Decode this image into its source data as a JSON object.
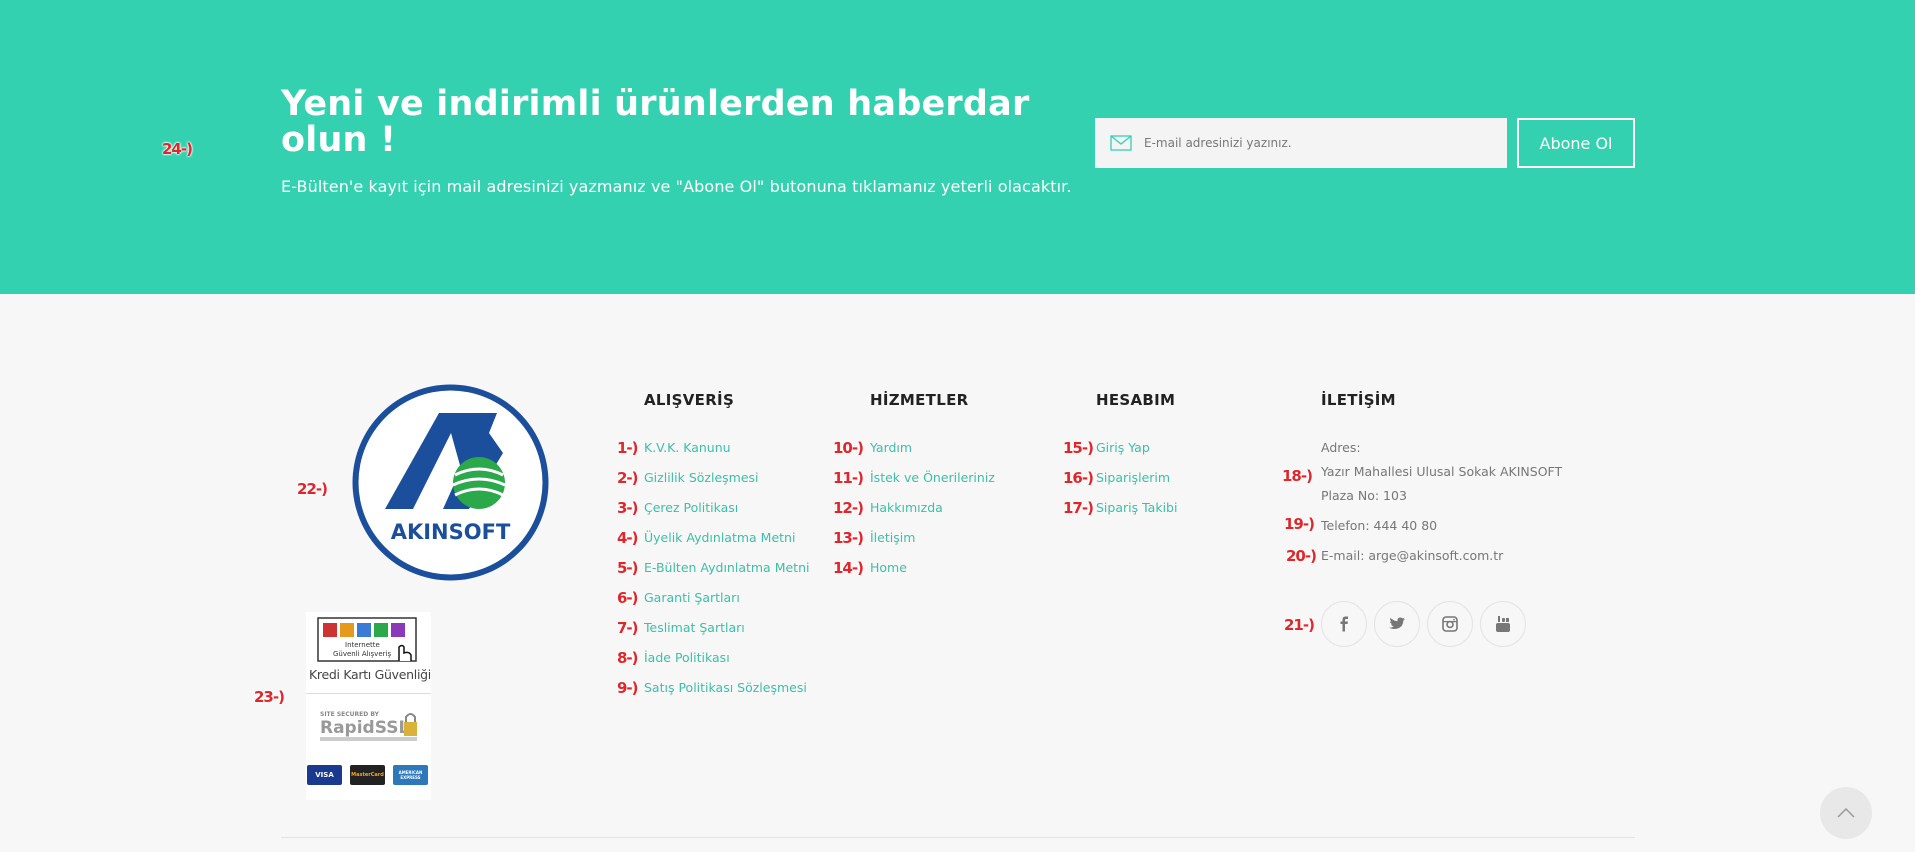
{
  "newsletter": {
    "title": "Yeni ve indirimli ürünlerden haberdar olun !",
    "description": "E-Bülten'e kayıt için mail adresinizi yazmanız ve \"Abone Ol\" butonuna tıklamanız yeterli olacaktır.",
    "email_placeholder": "E-mail adresinizi yazınız.",
    "subscribe_label": "Abone Ol",
    "marker": "24-)"
  },
  "logo": {
    "text": "AKINSOFT",
    "marker": "22-)"
  },
  "badges": {
    "guvenli_top": "Internette",
    "guvenli_bottom": "Güvenli Alışveriş",
    "kredi_label": "Kredi Kartı Güvenliği",
    "ssl_top": "SITE SECURED BY",
    "ssl_name": "RapidSSL",
    "cards": [
      "VISA",
      "MasterCard",
      "AMERICAN EXPRESS"
    ],
    "marker": "23-)"
  },
  "columns": {
    "alisveris": {
      "heading": "ALIŞVERİŞ",
      "links": [
        {
          "marker": "1-)",
          "label": "K.V.K. Kanunu"
        },
        {
          "marker": "2-)",
          "label": "Gizlilik Sözleşmesi"
        },
        {
          "marker": "3-)",
          "label": "Çerez Politikası"
        },
        {
          "marker": "4-)",
          "label": "Üyelik Aydınlatma Metni"
        },
        {
          "marker": "5-)",
          "label": "E-Bülten Aydınlatma Metni"
        },
        {
          "marker": "6-)",
          "label": "Garanti Şartları"
        },
        {
          "marker": "7-)",
          "label": "Teslimat Şartları"
        },
        {
          "marker": "8-)",
          "label": "İade Politikası"
        },
        {
          "marker": "9-)",
          "label": "Satış Politikası Sözleşmesi"
        }
      ]
    },
    "hizmetler": {
      "heading": "HİZMETLER",
      "links": [
        {
          "marker": "10-)",
          "label": "Yardım"
        },
        {
          "marker": "11-)",
          "label": "İstek ve Önerileriniz"
        },
        {
          "marker": "12-)",
          "label": "Hakkımızda"
        },
        {
          "marker": "13-)",
          "label": "İletişim"
        },
        {
          "marker": "14-)",
          "label": "Home"
        }
      ]
    },
    "hesabim": {
      "heading": "HESABIM",
      "links": [
        {
          "marker": "15-)",
          "label": "Giriş Yap"
        },
        {
          "marker": "16-)",
          "label": "Siparişlerim"
        },
        {
          "marker": "17-)",
          "label": "Sipariş Takibi"
        }
      ]
    },
    "iletisim": {
      "heading": "İLETİŞİM",
      "address_label": "Adres:",
      "address": "Yazır Mahallesi Ulusal Sokak AKINSOFT Plaza No: 103",
      "phone": "Telefon: 444 40 80",
      "email": "E-mail: arge@akinsoft.com.tr",
      "markers": [
        "18-)",
        "19-)",
        "20-)",
        "21-)"
      ]
    }
  },
  "socials": [
    "facebook-icon",
    "twitter-icon",
    "instagram-icon",
    "youtube-icon"
  ],
  "colors": {
    "accent": "#34d1b0",
    "link": "#3cbfa5",
    "marker": "#e0262b",
    "logo_blue": "#1b4f9c",
    "logo_green": "#2aa84a"
  }
}
